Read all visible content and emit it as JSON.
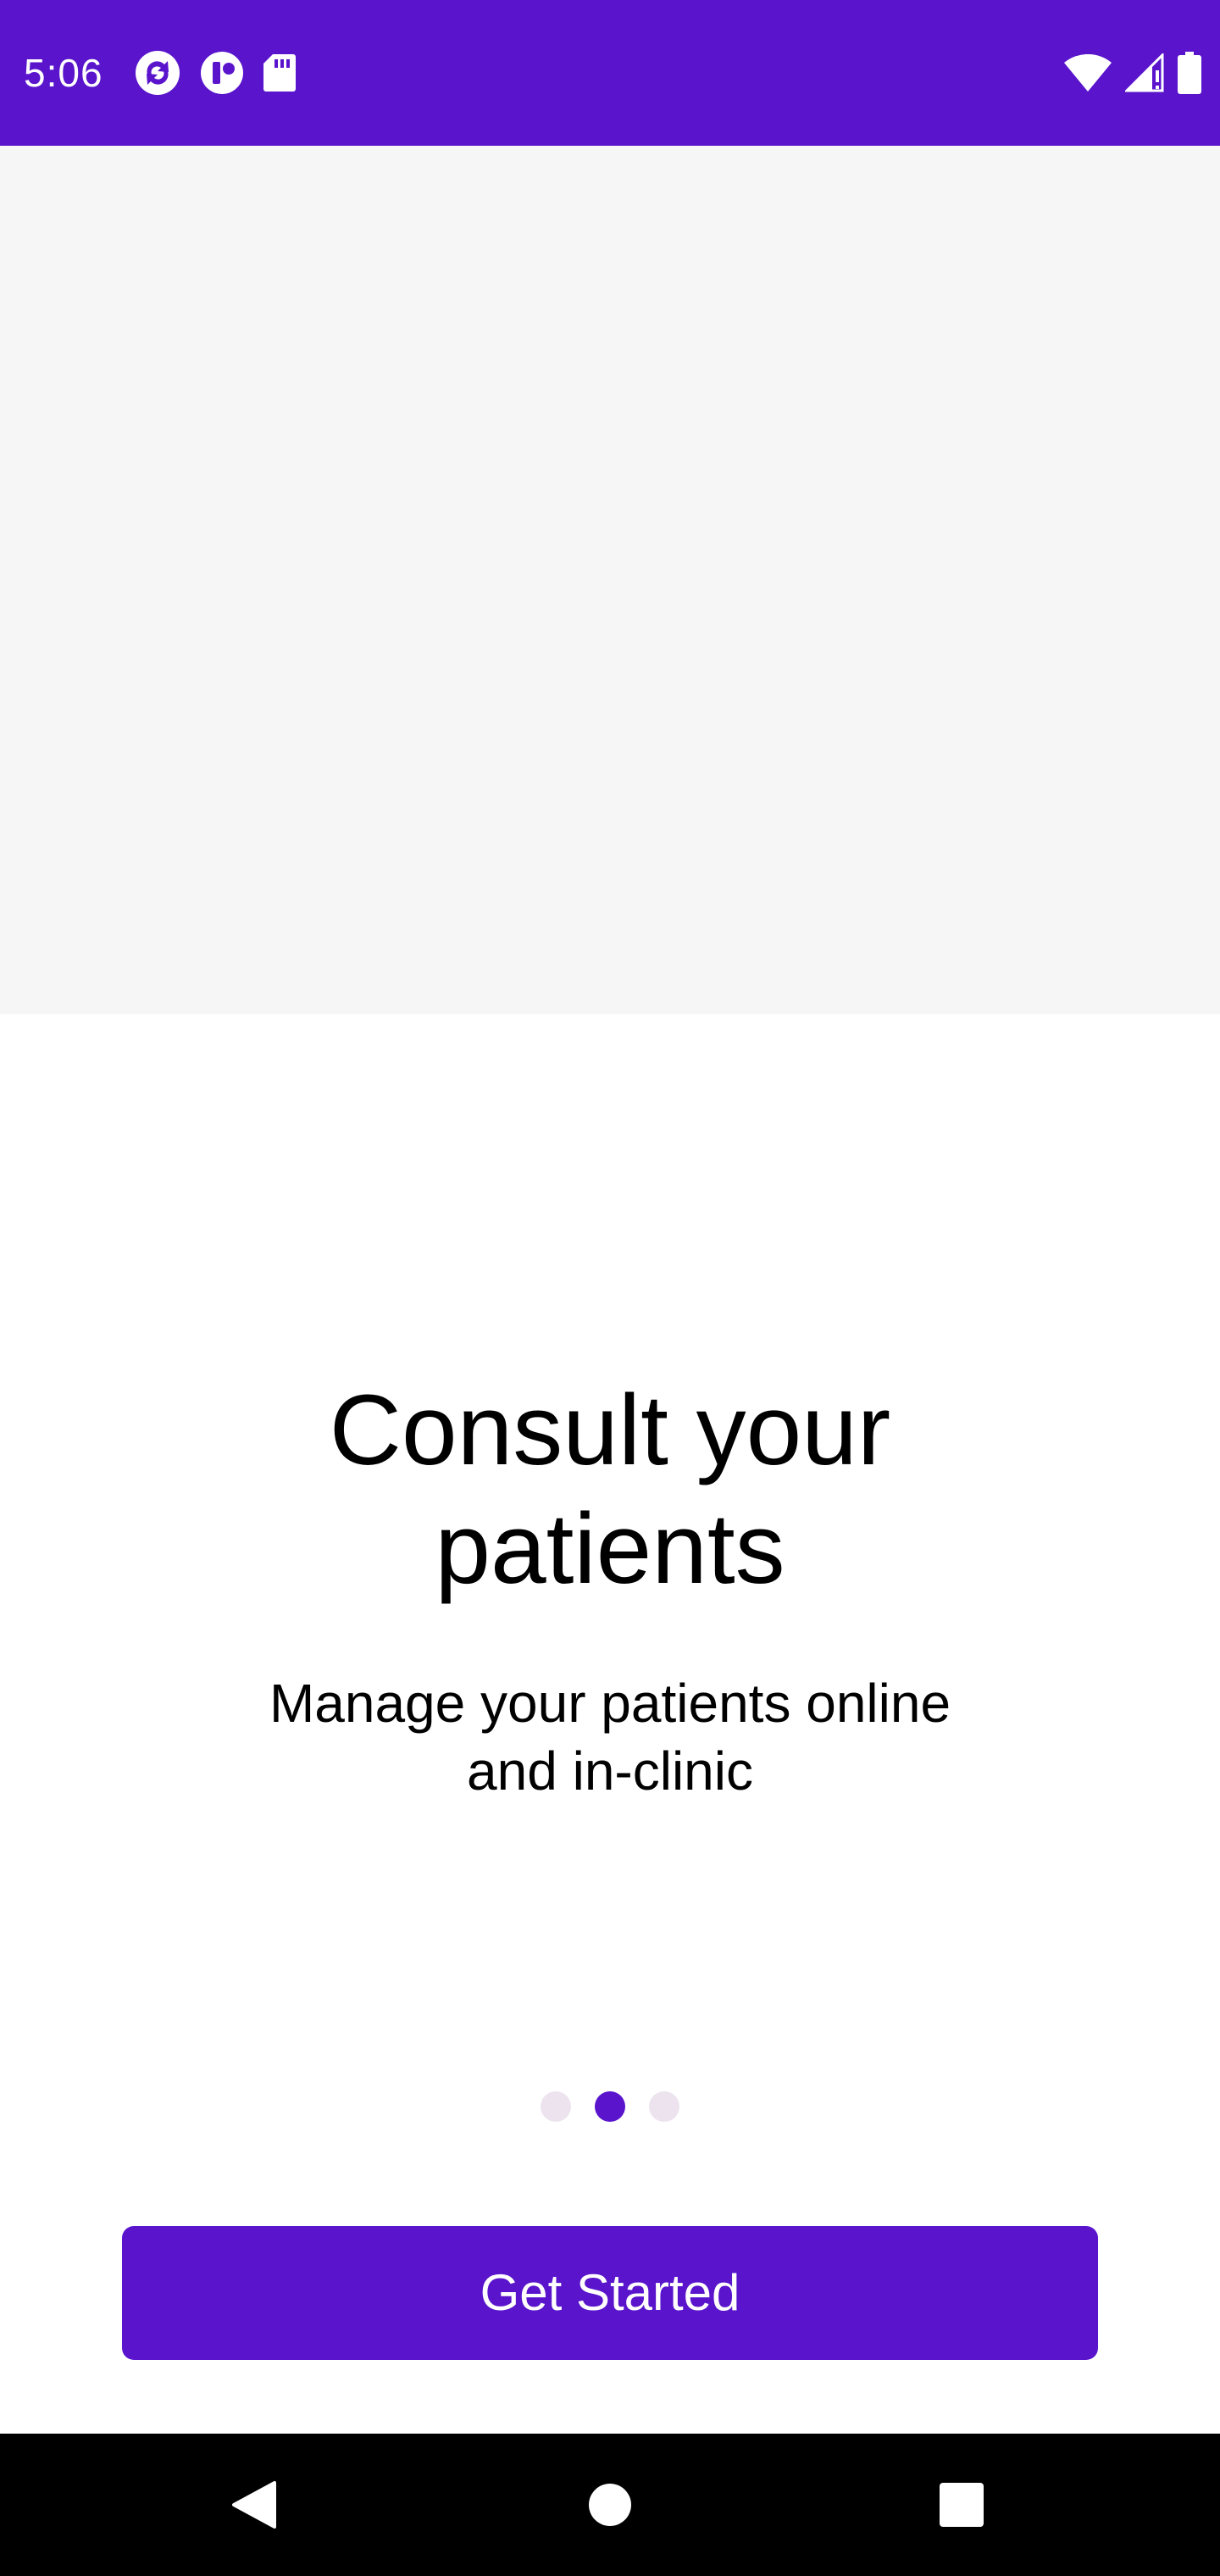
{
  "status_bar": {
    "time": "5:06",
    "notification_icons": [
      "sync-app-icon",
      "app-badge-icon",
      "sd-card-icon"
    ],
    "system_icons": [
      "wifi-icon",
      "signal-icon",
      "battery-icon"
    ],
    "background_color": "#5914cc"
  },
  "onboarding": {
    "headline_line1": "Consult your",
    "headline_line2": "patients",
    "subtitle_line1": "Manage your patients online",
    "subtitle_line2": "and in-clinic",
    "page_indicator": {
      "total_pages": 3,
      "current_page": 2,
      "active_color": "#5914cc",
      "inactive_color": "#ece3ee"
    },
    "cta_label": "Get Started",
    "accent_color": "#5914cc"
  },
  "nav_bar": {
    "buttons": [
      "back-icon",
      "home-icon",
      "recents-icon"
    ]
  }
}
